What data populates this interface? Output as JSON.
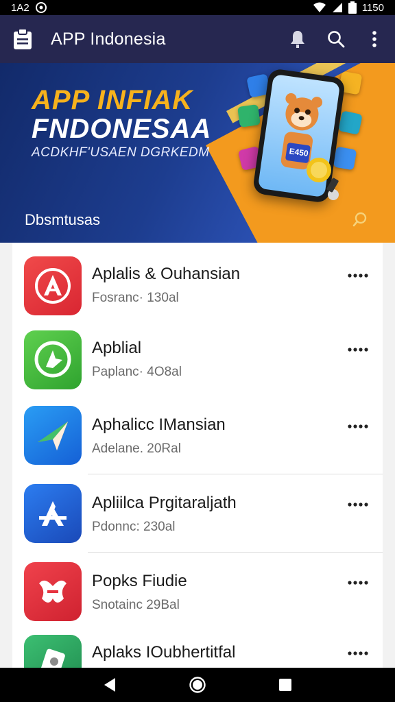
{
  "status_bar": {
    "time_left": "1A2",
    "time_right": "1150"
  },
  "app_bar": {
    "title": "APP Indonesia"
  },
  "banner": {
    "title_line1": "APP INFIAK",
    "title_line2": "FNDONESAA",
    "subtitle": "ACDKHF'USAEN DGRKEDM",
    "footer": "Dbsmtusas",
    "phone_badge": "E450"
  },
  "apps": [
    {
      "name": "Aplalis & Ouhansian",
      "meta": "Fosranc· 130al",
      "color": "#e53935",
      "icon": "letter-a-icon"
    },
    {
      "name": "Apblial",
      "meta": "Paplanc· 4O8al",
      "color": "#43b93b",
      "icon": "chat-icon"
    },
    {
      "name": "Aphalicc IMansian",
      "meta": "Adelane. 20Ral",
      "color": "#1f8be8",
      "icon": "paper-plane-icon"
    },
    {
      "name": "Apliilca Prgitaraljath",
      "meta": "Pdonnc: 230al",
      "color": "#1e5fd6",
      "icon": "app-store-icon"
    },
    {
      "name": "Popks Fiudie",
      "meta": "Snotainc 29Bal",
      "color": "#e6333f",
      "icon": "puzzle-icon"
    },
    {
      "name": "Aplaks IOubhertitfal",
      "meta": "",
      "color": "#2fa463",
      "icon": "photo-icon"
    }
  ]
}
